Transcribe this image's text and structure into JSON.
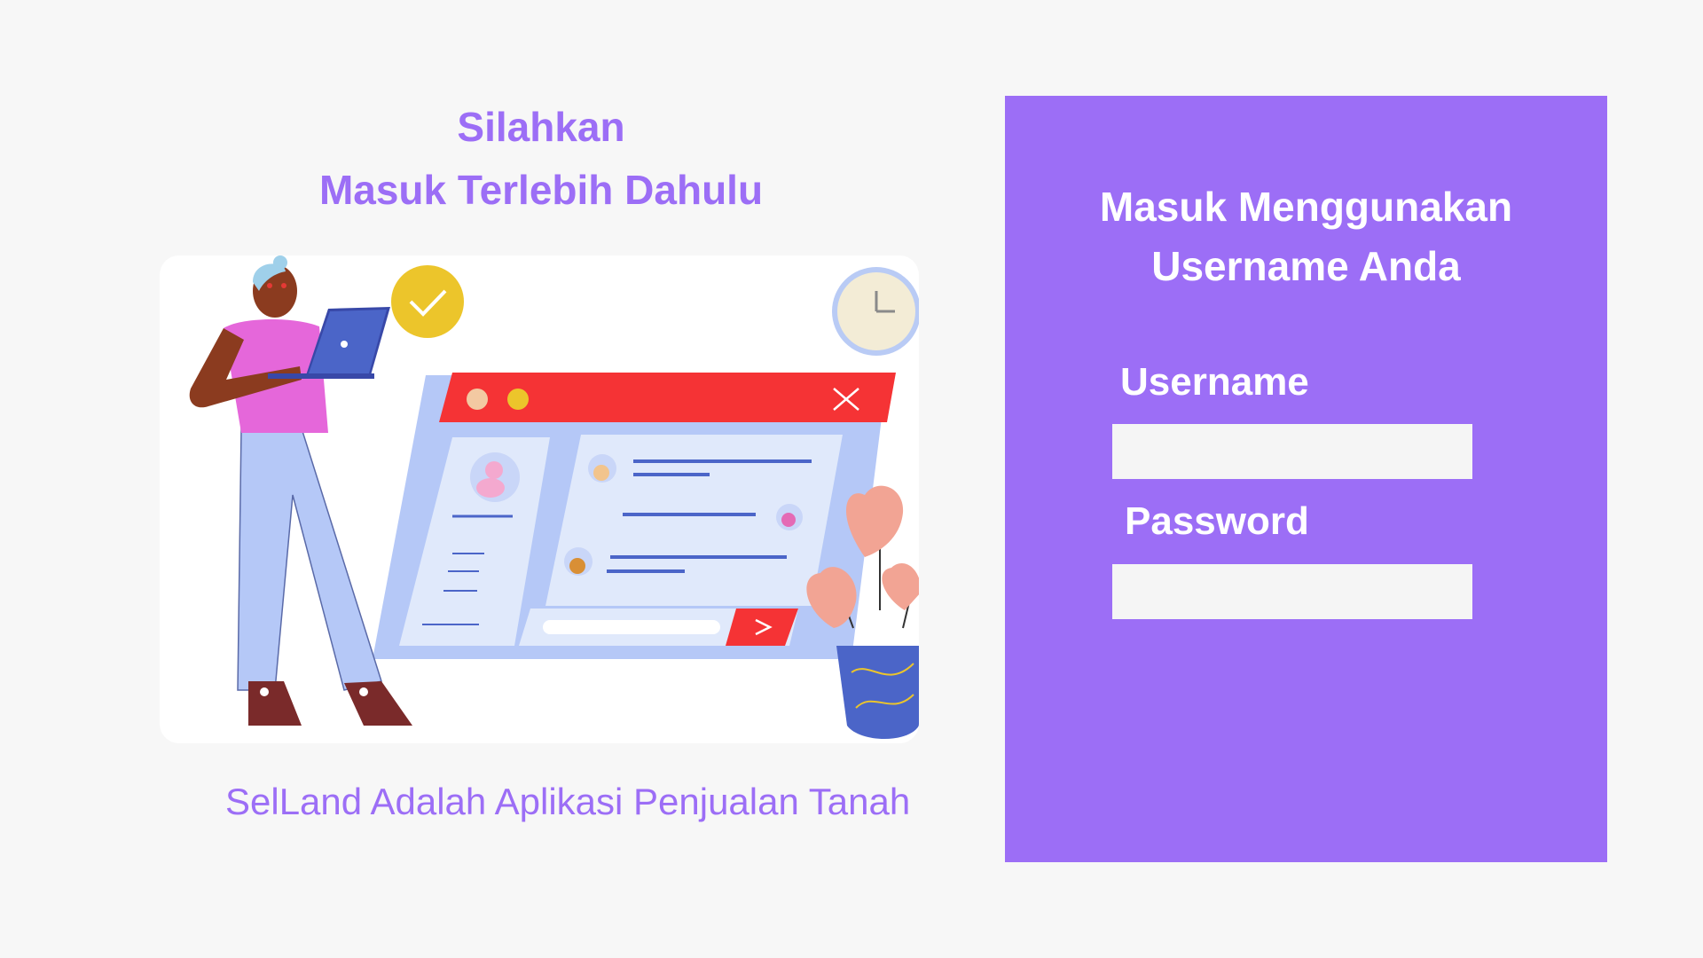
{
  "left": {
    "title_line1": "Silahkan",
    "title_line2": "Masuk Terlebih Dahulu",
    "tagline": "SelLand Adalah Aplikasi Penjualan Tanah"
  },
  "login": {
    "heading_line1": "Masuk Menggunakan",
    "heading_line2": "Username Anda",
    "username_label": "Username",
    "username_value": "",
    "password_label": "Password",
    "password_value": ""
  },
  "colors": {
    "accent": "#9c6ef6",
    "background": "#f7f7f7",
    "input_bg": "#f5f5f5"
  },
  "icons": {
    "illustration": "person-with-laptop-browser-illustration",
    "check": "check-circle-icon",
    "clock": "clock-icon",
    "close": "close-icon",
    "send": "send-arrow-icon"
  }
}
